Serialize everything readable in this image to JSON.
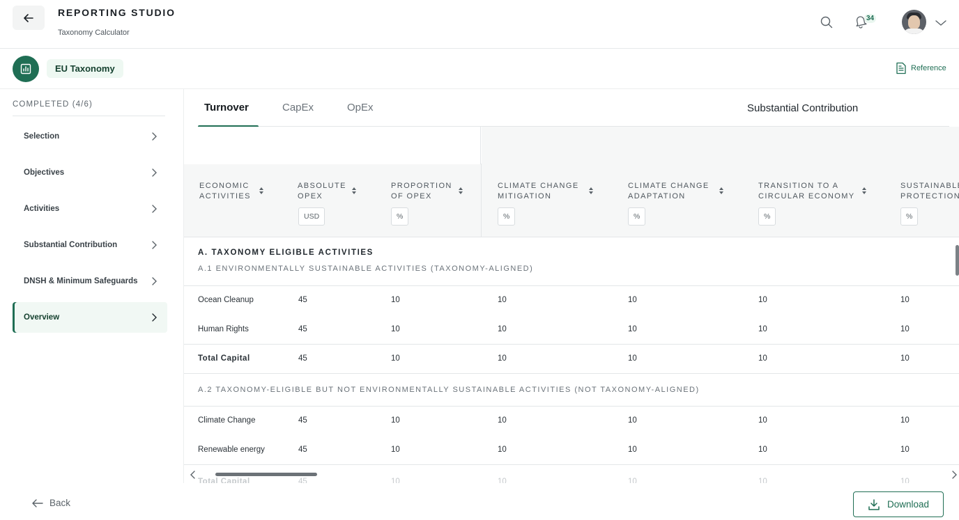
{
  "header": {
    "title": "REPORTING STUDIO",
    "subtitle": "Taxonomy Calculator",
    "notification_count": "34"
  },
  "module": {
    "name": "EU Taxonomy",
    "reference_label": "Reference"
  },
  "sidebar": {
    "progress_label": "COMPLETED (4/6)",
    "items": [
      {
        "label": "Selection"
      },
      {
        "label": "Objectives"
      },
      {
        "label": "Activities"
      },
      {
        "label": "Substantial Contribution"
      },
      {
        "label": "DNSH & Minimum Safeguards"
      },
      {
        "label": "Overview"
      }
    ]
  },
  "tabs": [
    {
      "label": "Turnover"
    },
    {
      "label": "CapEx"
    },
    {
      "label": "OpEx"
    }
  ],
  "table": {
    "group_header": "Substantial Contribution",
    "columns": [
      {
        "title_line1": "ECONOMIC",
        "title_line2": "ACTIVITIES",
        "unit": ""
      },
      {
        "title_line1": "ABSOLUTE",
        "title_line2": "OPEX",
        "unit": "USD"
      },
      {
        "title_line1": "PROPORTION",
        "title_line2": "OF OPEX",
        "unit": "%"
      },
      {
        "title_line1": "CLIMATE CHANGE",
        "title_line2": "MITIGATION",
        "unit": "%"
      },
      {
        "title_line1": "CLIMATE CHANGE",
        "title_line2": "ADAPTATION",
        "unit": "%"
      },
      {
        "title_line1": "TRANSITION TO A",
        "title_line2": "CIRCULAR ECONOMY",
        "unit": "%"
      },
      {
        "title_line1": "SUSTAINABLE",
        "title_line2": "PROTECTION",
        "unit": "%"
      }
    ],
    "section_a": {
      "title": "A. TAXONOMY ELIGIBLE ACTIVITIES",
      "a1_title": "A.1 ENVIRONMENTALLY SUSTAINABLE ACTIVITIES (TAXONOMY-ALIGNED)",
      "a1_rows": [
        [
          "Ocean Cleanup",
          "45",
          "10",
          "10",
          "10",
          "10",
          "10"
        ],
        [
          "Human Rights",
          "45",
          "10",
          "10",
          "10",
          "10",
          "10"
        ],
        [
          "Total Capital",
          "45",
          "10",
          "10",
          "10",
          "10",
          "10"
        ]
      ],
      "a2_title": "A.2 TAXONOMY-ELIGIBLE BUT NOT ENVIRONMENTALLY SUSTAINABLE ACTIVITIES (NOT TAXONOMY-ALIGNED)",
      "a2_rows": [
        [
          "Climate Change",
          "45",
          "10",
          "10",
          "10",
          "10",
          "10"
        ],
        [
          "Renewable energy",
          "45",
          "10",
          "10",
          "10",
          "10",
          "10"
        ],
        [
          "Total Capital",
          "45",
          "10",
          "10",
          "10",
          "10",
          "10"
        ]
      ]
    }
  },
  "footer": {
    "back_label": "Back",
    "download_label": "Download"
  }
}
